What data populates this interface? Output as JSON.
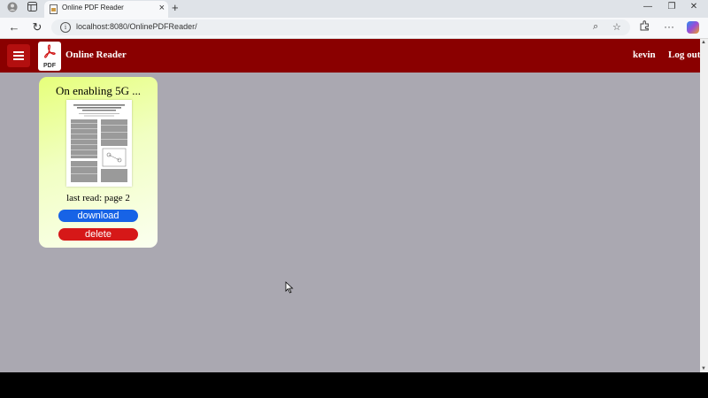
{
  "browser": {
    "tab_title": "Online PDF Reader",
    "tab_close": "×",
    "new_tab": "+",
    "address": "localhost:8080/OnlinePDFReader/",
    "buttons": {
      "back": "←",
      "reload": "↻",
      "zoom": "⌕",
      "favorite": "☆",
      "more": "···",
      "minimize": "—",
      "restore": "❐",
      "close": "✕"
    }
  },
  "header": {
    "logo_text": "PDF",
    "brand": "Online Reader",
    "username": "kevin",
    "logout_label": "Log out"
  },
  "document_card": {
    "title": "On enabling 5G ...",
    "last_read": "last read: page 2",
    "download_label": "download",
    "delete_label": "delete"
  },
  "colors": {
    "header_bg": "#8a0000",
    "page_bg": "#aaa8b1",
    "download": "#1763e6",
    "delete": "#d61818"
  }
}
